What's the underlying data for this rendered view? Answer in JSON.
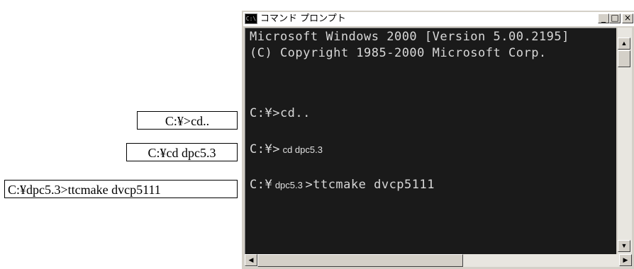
{
  "callouts": [
    {
      "text": "C:¥>cd.."
    },
    {
      "text": "C:¥cd dpc5.3"
    },
    {
      "text": "C:¥dpc5.3>ttcmake dvcp5111"
    }
  ],
  "window": {
    "title": "コマンド プロンプト",
    "icon_text": "C:\\",
    "buttons": {
      "minimize": "_",
      "maximize": "□",
      "close": "×"
    }
  },
  "console": {
    "line1": "Microsoft Windows 2000 [Version 5.00.2195]",
    "line2": "(C) Copyright 1985-2000 Microsoft Corp.",
    "line3": "C:¥>cd..",
    "line4_prefix": "C:¥>",
    "line4_cmd": " cd dpc5.3",
    "line5_prefix": "C:¥",
    "line5_dir": " dpc5.3 ",
    "line5_cmd": ">ttcmake dvcp5111"
  },
  "scrollbars": {
    "up_arrow": "▲",
    "down_arrow": "▼",
    "left_arrow": "◀",
    "right_arrow": "▶"
  },
  "colors": {
    "console_bg": "#1a1a1a",
    "console_text": "#d8d8d8",
    "chrome": "#d4d0c8"
  }
}
